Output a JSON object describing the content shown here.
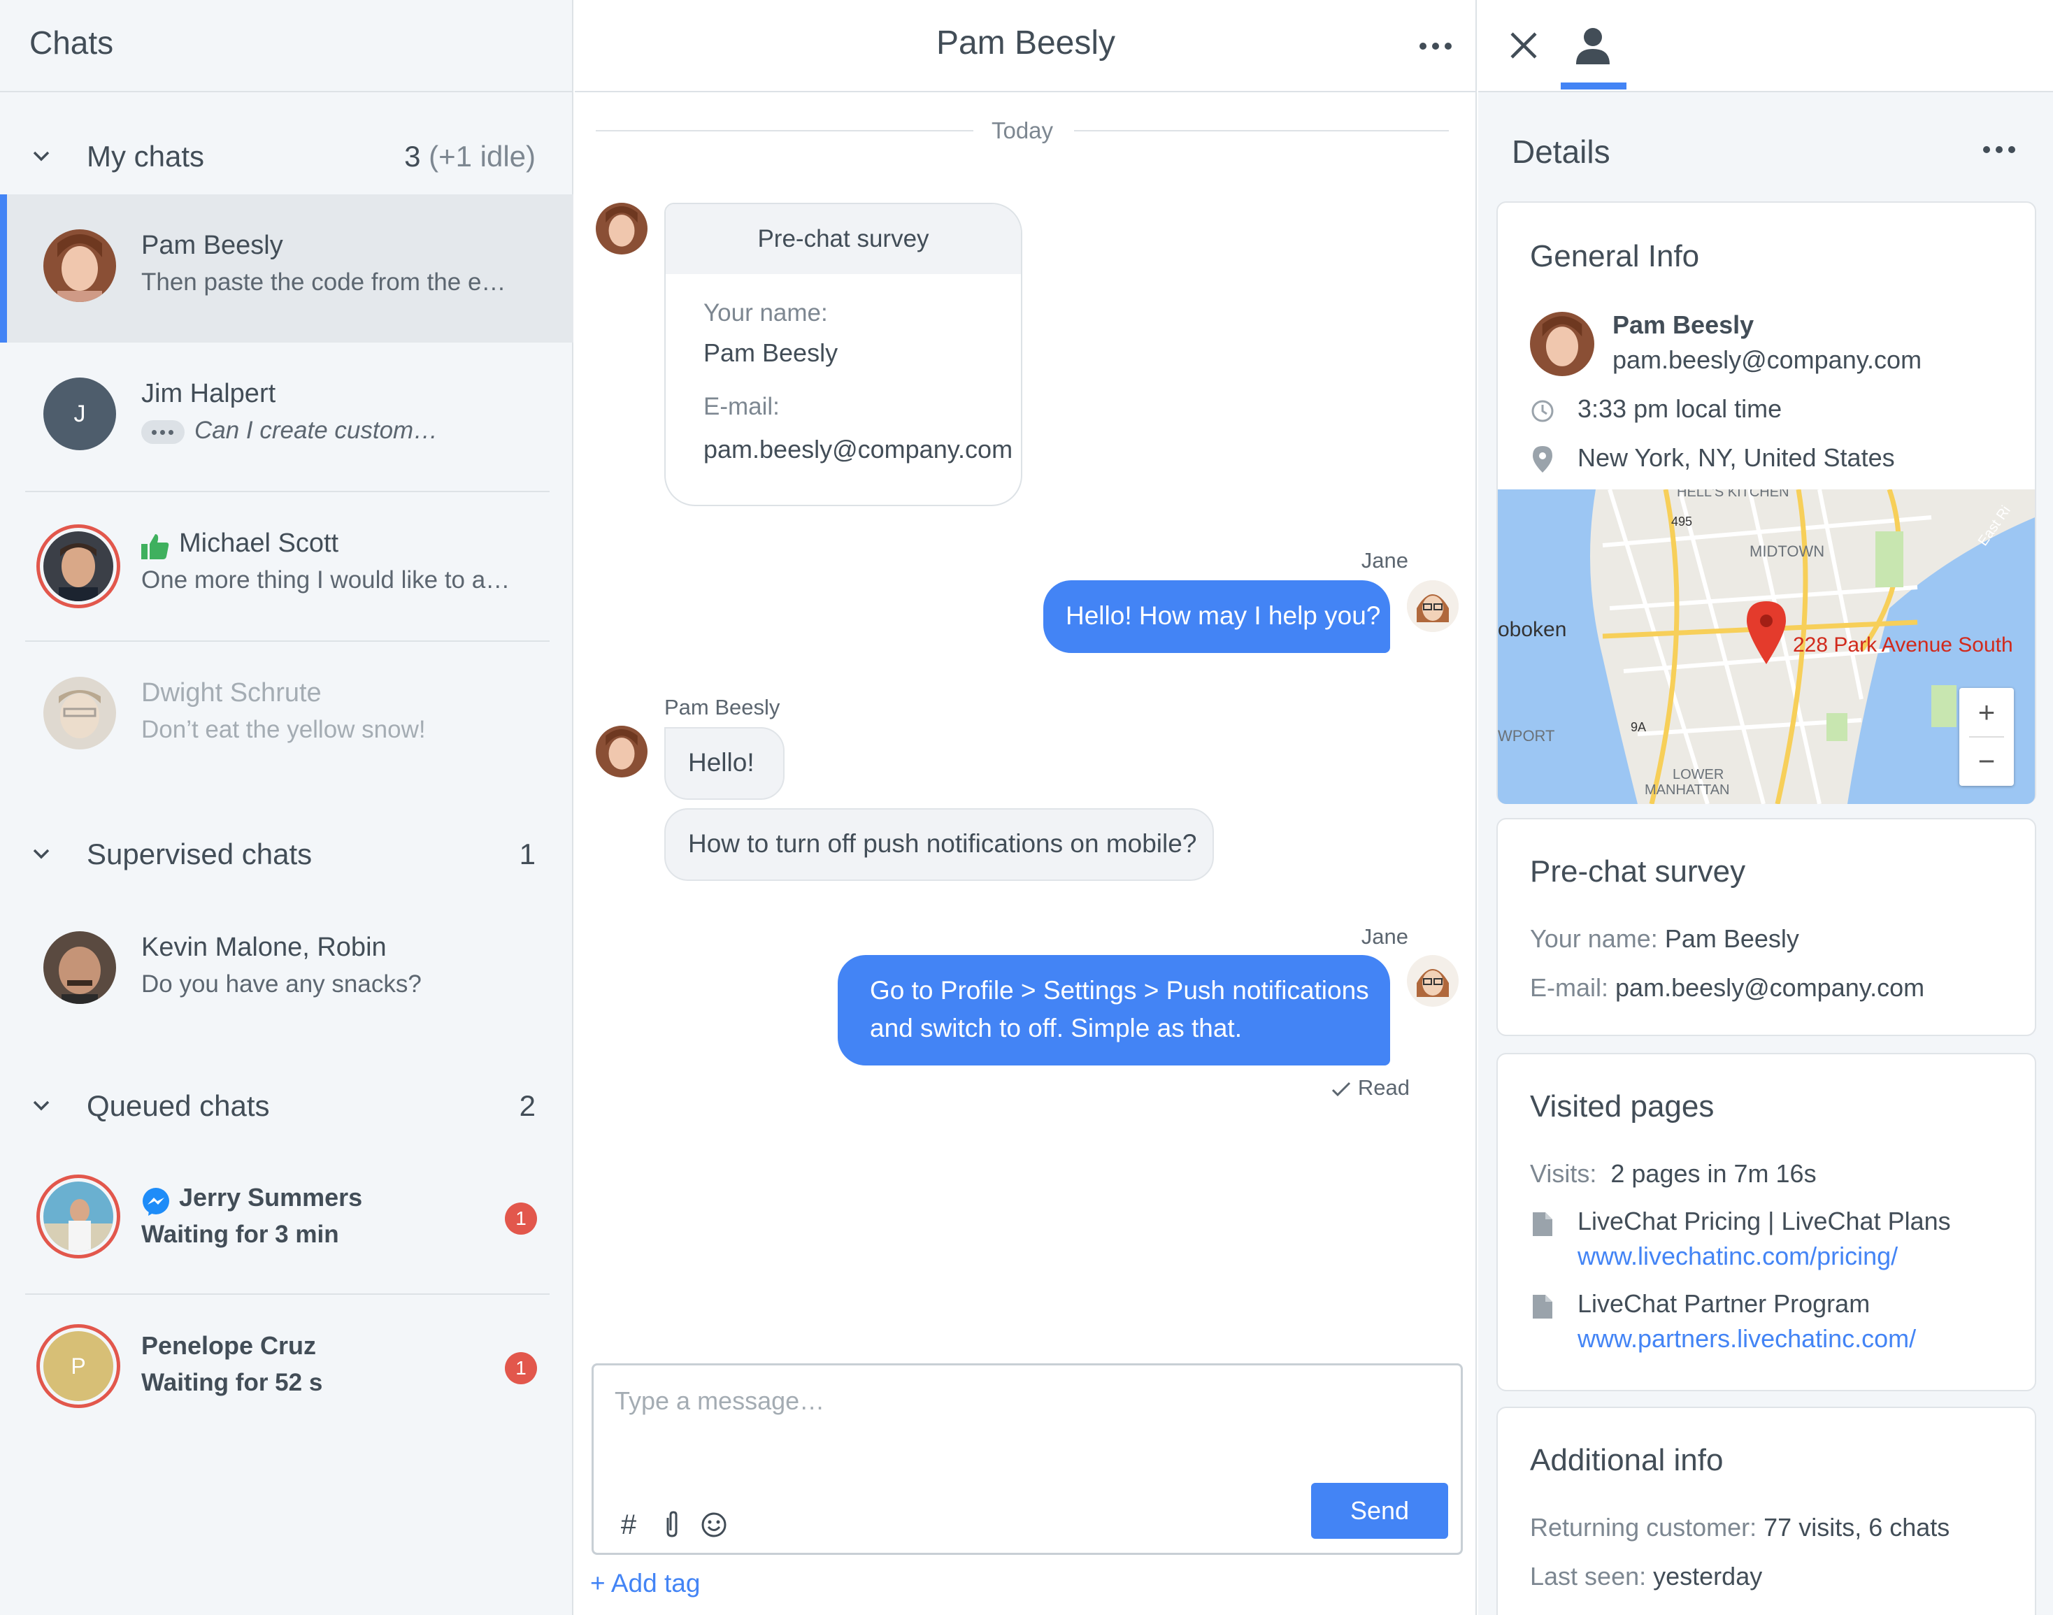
{
  "left": {
    "title": "Chats",
    "sections": {
      "my": {
        "label": "My chats",
        "count": "3",
        "idle": "(+1 idle)"
      },
      "supervised": {
        "label": "Supervised chats",
        "count": "1"
      },
      "queued": {
        "label": "Queued chats",
        "count": "2"
      }
    },
    "chats": [
      {
        "name": "Pam Beesly",
        "preview": "Then paste the code from the e…"
      },
      {
        "name": "Jim Halpert",
        "preview": "Can I create custom…",
        "initial": "J"
      },
      {
        "name": "Michael Scott",
        "preview": "One more thing I would like to a…"
      },
      {
        "name": "Dwight Schrute",
        "preview": "Don’t eat the yellow snow!"
      },
      {
        "name": "Kevin Malone, Robin",
        "preview": "Do you have any snacks?"
      },
      {
        "name": "Jerry Summers",
        "preview": "Waiting for 3 min",
        "badge": "1"
      },
      {
        "name": "Penelope Cruz",
        "preview": "Waiting for 52 s",
        "badge": "1",
        "initial": "P"
      }
    ]
  },
  "chat": {
    "title": "Pam Beesly",
    "divider": "Today",
    "survey": {
      "header": "Pre-chat survey",
      "name_label": "Your name:",
      "name_value": "Pam Beesly",
      "email_label": "E-mail:",
      "email_value": "pam.beesly@company.com"
    },
    "messages": [
      {
        "sender": "Jane",
        "text": "Hello! How may I help you?"
      },
      {
        "sender": "Pam Beesly",
        "text": "Hello!"
      },
      {
        "text": "How to turn off push notifications on mobile?"
      },
      {
        "sender": "Jane",
        "line1": "Go to Profile > Settings > Push notifications",
        "line2": "and switch to off. Simple as that."
      }
    ],
    "read_status": "Read",
    "composer": {
      "placeholder": "Type a message…",
      "send_label": "Send",
      "add_tag": "+ Add tag"
    }
  },
  "details": {
    "title": "Details",
    "general": {
      "title": "General Info",
      "name": "Pam Beesly",
      "email": "pam.beesly@company.com",
      "local_time": "3:33 pm local time",
      "location": "New York, NY, United States"
    },
    "map": {
      "address": "228 Park Avenue South",
      "labels": [
        "HELL'S KITCHEN",
        "MIDTOWN",
        "oboken",
        "WPORT",
        "LOWER",
        "MANHATTAN",
        "495",
        "9A",
        "East Ri"
      ],
      "zoom_in": "+",
      "zoom_out": "−"
    },
    "prechat": {
      "title": "Pre-chat survey",
      "name_label": "Your name:",
      "name_value": "Pam Beesly",
      "email_label": "E-mail:",
      "email_value": "pam.beesly@company.com"
    },
    "visited": {
      "title": "Visited pages",
      "visits_label": "Visits:",
      "visits_value": "2 pages in 7m 16s",
      "pages": [
        {
          "title": "LiveChat Pricing | LiveChat Plans",
          "url": "www.livechatinc.com/pricing/"
        },
        {
          "title": "LiveChat Partner Program",
          "url": "www.partners.livechatinc.com/"
        }
      ]
    },
    "additional": {
      "title": "Additional info",
      "returning_label": "Returning customer:",
      "returning_value": "77 visits, 6 chats",
      "last_seen_label": "Last seen:",
      "last_seen_value": "yesterday"
    }
  },
  "colors": {
    "accent": "#4384f5",
    "alert": "#e2574c",
    "thumbs": "#3fb05e"
  }
}
